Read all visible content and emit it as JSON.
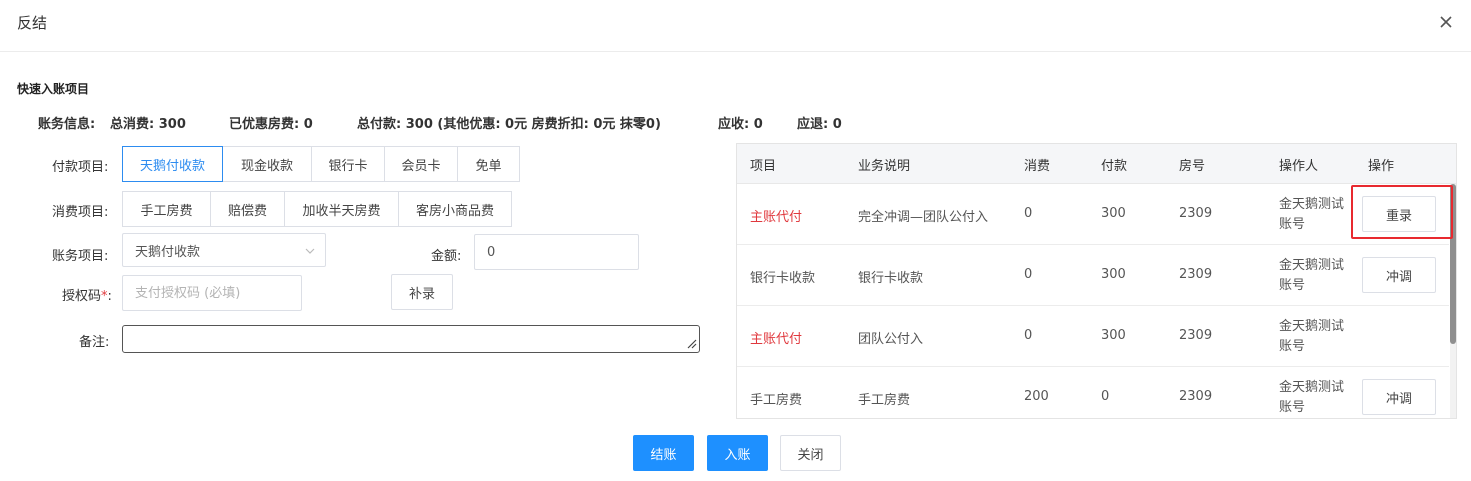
{
  "dialog": {
    "title": "反结"
  },
  "section": {
    "title": "快速入账项目"
  },
  "account_info": {
    "label": "账务信息:",
    "total_consumption": "总消费: 300",
    "discounted_room_fee": "已优惠房费: 0",
    "total_payment": "总付款: 300 (其他优惠: 0元 房费折扣: 0元 抹零0)",
    "receivable": "应收: 0",
    "refundable": "应退: 0"
  },
  "payment_items": {
    "label": "付款项目:",
    "options": [
      "天鹅付收款",
      "现金收款",
      "银行卡",
      "会员卡",
      "免单"
    ],
    "selected": "天鹅付收款"
  },
  "consumption_items": {
    "label": "消费项目:",
    "options": [
      "手工房费",
      "赔偿费",
      "加收半天房费",
      "客房小商品费"
    ]
  },
  "account_item": {
    "label": "账务项目:",
    "value": "天鹅付收款"
  },
  "amount": {
    "label": "金额:",
    "value": "0"
  },
  "auth_code": {
    "label": "授权码",
    "required_mark": "*",
    "colon": ":",
    "placeholder": "支付授权码 (必填)"
  },
  "supplement_button": {
    "label": "补录"
  },
  "remarks": {
    "label": "备注:",
    "value": ""
  },
  "table": {
    "headers": [
      "项目",
      "业务说明",
      "消费",
      "付款",
      "房号",
      "操作人",
      "操作"
    ],
    "rows": [
      {
        "item": "主账代付",
        "desc": "完全冲调—团队公付入",
        "consume": "0",
        "pay": "300",
        "room": "2309",
        "operator_line1": "金天鹅测试",
        "operator_line2": "账号",
        "action": "重录"
      },
      {
        "item": "银行卡收款",
        "desc": "银行卡收款",
        "consume": "0",
        "pay": "300",
        "room": "2309",
        "operator_line1": "金天鹅测试",
        "operator_line2": "账号",
        "action": "冲调"
      },
      {
        "item": "主账代付",
        "desc": "团队公付入",
        "consume": "0",
        "pay": "300",
        "room": "2309",
        "operator_line1": "金天鹅测试",
        "operator_line2": "账号",
        "action": ""
      },
      {
        "item": "手工房费",
        "desc": "手工房费",
        "consume": "200",
        "pay": "0",
        "room": "2309",
        "operator_line1": "金天鹅测试",
        "operator_line2": "账号",
        "action": "冲调"
      }
    ]
  },
  "footer": {
    "checkout": "结账",
    "post": "入账",
    "close": "关闭"
  },
  "colors": {
    "primary": "#1e90ff",
    "accent_blue": "#2d8cf0",
    "red_text": "#e0393e",
    "highlight_border": "#e8292f"
  }
}
